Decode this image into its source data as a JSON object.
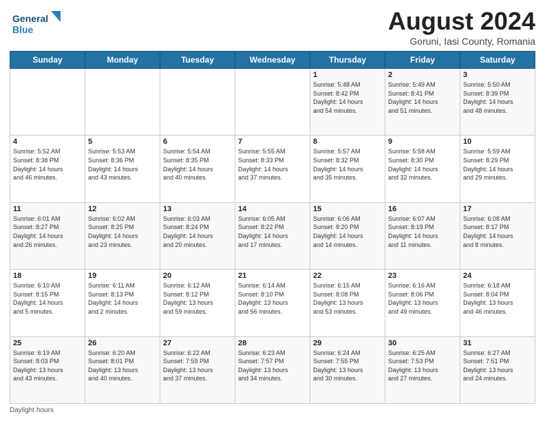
{
  "header": {
    "logo_line1": "General",
    "logo_line2": "Blue",
    "month_title": "August 2024",
    "location": "Goruni, Iasi County, Romania"
  },
  "footer": {
    "note": "Daylight hours"
  },
  "weekdays": [
    "Sunday",
    "Monday",
    "Tuesday",
    "Wednesday",
    "Thursday",
    "Friday",
    "Saturday"
  ],
  "weeks": [
    [
      {
        "day": "",
        "info": ""
      },
      {
        "day": "",
        "info": ""
      },
      {
        "day": "",
        "info": ""
      },
      {
        "day": "",
        "info": ""
      },
      {
        "day": "1",
        "info": "Sunrise: 5:48 AM\nSunset: 8:42 PM\nDaylight: 14 hours\nand 54 minutes."
      },
      {
        "day": "2",
        "info": "Sunrise: 5:49 AM\nSunset: 8:41 PM\nDaylight: 14 hours\nand 51 minutes."
      },
      {
        "day": "3",
        "info": "Sunrise: 5:50 AM\nSunset: 8:39 PM\nDaylight: 14 hours\nand 48 minutes."
      }
    ],
    [
      {
        "day": "4",
        "info": "Sunrise: 5:52 AM\nSunset: 8:38 PM\nDaylight: 14 hours\nand 46 minutes."
      },
      {
        "day": "5",
        "info": "Sunrise: 5:53 AM\nSunset: 8:36 PM\nDaylight: 14 hours\nand 43 minutes."
      },
      {
        "day": "6",
        "info": "Sunrise: 5:54 AM\nSunset: 8:35 PM\nDaylight: 14 hours\nand 40 minutes."
      },
      {
        "day": "7",
        "info": "Sunrise: 5:55 AM\nSunset: 8:33 PM\nDaylight: 14 hours\nand 37 minutes."
      },
      {
        "day": "8",
        "info": "Sunrise: 5:57 AM\nSunset: 8:32 PM\nDaylight: 14 hours\nand 35 minutes."
      },
      {
        "day": "9",
        "info": "Sunrise: 5:58 AM\nSunset: 8:30 PM\nDaylight: 14 hours\nand 32 minutes."
      },
      {
        "day": "10",
        "info": "Sunrise: 5:59 AM\nSunset: 8:29 PM\nDaylight: 14 hours\nand 29 minutes."
      }
    ],
    [
      {
        "day": "11",
        "info": "Sunrise: 6:01 AM\nSunset: 8:27 PM\nDaylight: 14 hours\nand 26 minutes."
      },
      {
        "day": "12",
        "info": "Sunrise: 6:02 AM\nSunset: 8:25 PM\nDaylight: 14 hours\nand 23 minutes."
      },
      {
        "day": "13",
        "info": "Sunrise: 6:03 AM\nSunset: 8:24 PM\nDaylight: 14 hours\nand 20 minutes."
      },
      {
        "day": "14",
        "info": "Sunrise: 6:05 AM\nSunset: 8:22 PM\nDaylight: 14 hours\nand 17 minutes."
      },
      {
        "day": "15",
        "info": "Sunrise: 6:06 AM\nSunset: 8:20 PM\nDaylight: 14 hours\nand 14 minutes."
      },
      {
        "day": "16",
        "info": "Sunrise: 6:07 AM\nSunset: 8:19 PM\nDaylight: 14 hours\nand 11 minutes."
      },
      {
        "day": "17",
        "info": "Sunrise: 6:08 AM\nSunset: 8:17 PM\nDaylight: 14 hours\nand 8 minutes."
      }
    ],
    [
      {
        "day": "18",
        "info": "Sunrise: 6:10 AM\nSunset: 8:15 PM\nDaylight: 14 hours\nand 5 minutes."
      },
      {
        "day": "19",
        "info": "Sunrise: 6:11 AM\nSunset: 8:13 PM\nDaylight: 14 hours\nand 2 minutes."
      },
      {
        "day": "20",
        "info": "Sunrise: 6:12 AM\nSunset: 8:12 PM\nDaylight: 13 hours\nand 59 minutes."
      },
      {
        "day": "21",
        "info": "Sunrise: 6:14 AM\nSunset: 8:10 PM\nDaylight: 13 hours\nand 56 minutes."
      },
      {
        "day": "22",
        "info": "Sunrise: 6:15 AM\nSunset: 8:08 PM\nDaylight: 13 hours\nand 53 minutes."
      },
      {
        "day": "23",
        "info": "Sunrise: 6:16 AM\nSunset: 8:06 PM\nDaylight: 13 hours\nand 49 minutes."
      },
      {
        "day": "24",
        "info": "Sunrise: 6:18 AM\nSunset: 8:04 PM\nDaylight: 13 hours\nand 46 minutes."
      }
    ],
    [
      {
        "day": "25",
        "info": "Sunrise: 6:19 AM\nSunset: 8:03 PM\nDaylight: 13 hours\nand 43 minutes."
      },
      {
        "day": "26",
        "info": "Sunrise: 6:20 AM\nSunset: 8:01 PM\nDaylight: 13 hours\nand 40 minutes."
      },
      {
        "day": "27",
        "info": "Sunrise: 6:22 AM\nSunset: 7:59 PM\nDaylight: 13 hours\nand 37 minutes."
      },
      {
        "day": "28",
        "info": "Sunrise: 6:23 AM\nSunset: 7:57 PM\nDaylight: 13 hours\nand 34 minutes."
      },
      {
        "day": "29",
        "info": "Sunrise: 6:24 AM\nSunset: 7:55 PM\nDaylight: 13 hours\nand 30 minutes."
      },
      {
        "day": "30",
        "info": "Sunrise: 6:25 AM\nSunset: 7:53 PM\nDaylight: 13 hours\nand 27 minutes."
      },
      {
        "day": "31",
        "info": "Sunrise: 6:27 AM\nSunset: 7:51 PM\nDaylight: 13 hours\nand 24 minutes."
      }
    ]
  ]
}
